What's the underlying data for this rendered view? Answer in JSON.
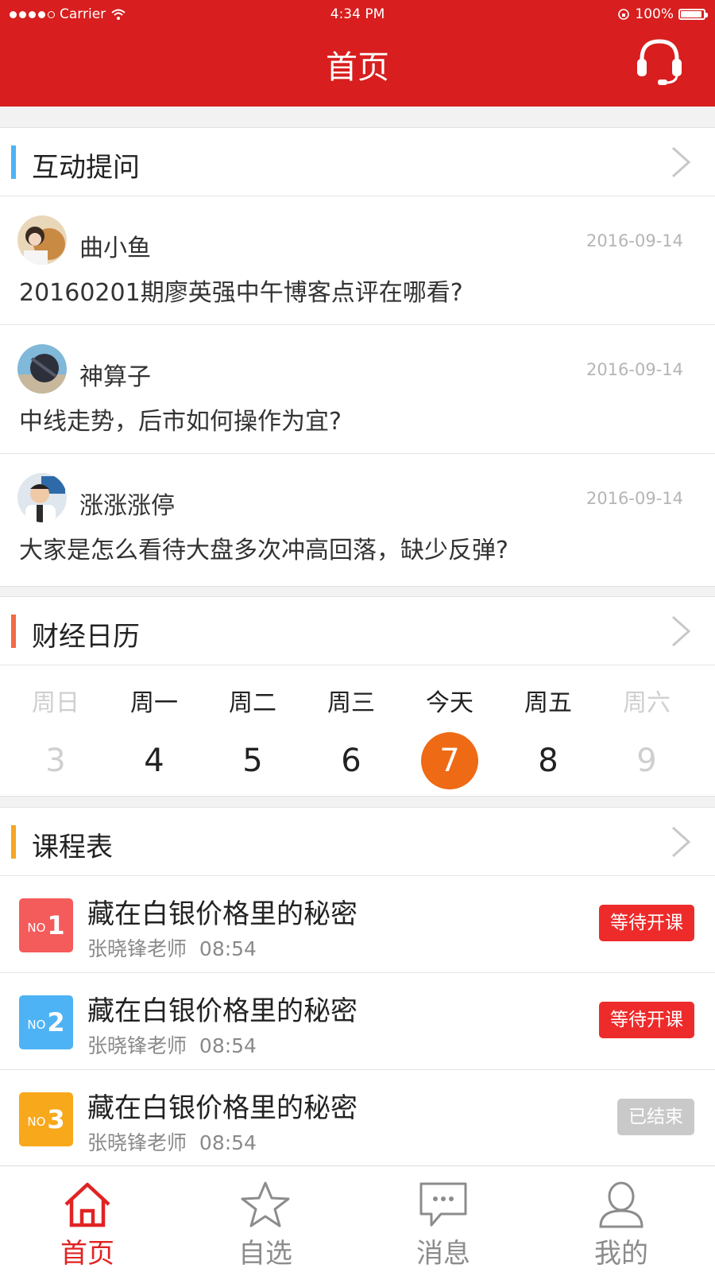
{
  "status_bar": {
    "carrier": "Carrier",
    "time": "4:34 PM",
    "battery": "100%"
  },
  "header": {
    "title": "首页",
    "support_icon": "headset-icon"
  },
  "qa": {
    "title": "互动提问",
    "accent": "#4db3f5",
    "items": [
      {
        "name": "曲小鱼",
        "date": "2016-09-14",
        "question": "20160201期廖英强中午博客点评在哪看?"
      },
      {
        "name": "神算子",
        "date": "2016-09-14",
        "question": "中线走势，后市如何操作为宜?"
      },
      {
        "name": "涨涨涨停",
        "date": "2016-09-14",
        "question": "大家是怎么看待大盘多次冲高回落，缺少反弹?"
      }
    ]
  },
  "calendar": {
    "title": "财经日历",
    "accent": "#f36a45",
    "today_color": "#ef6a14",
    "days": [
      {
        "name": "周日",
        "num": "3"
      },
      {
        "name": "周一",
        "num": "4"
      },
      {
        "name": "周二",
        "num": "5"
      },
      {
        "name": "周三",
        "num": "6"
      },
      {
        "name": "今天",
        "num": "7"
      },
      {
        "name": "周五",
        "num": "8"
      },
      {
        "name": "周六",
        "num": "9"
      }
    ]
  },
  "courses": {
    "title": "课程表",
    "accent": "#f6a623",
    "items": [
      {
        "no": "NO",
        "num": "1",
        "title": "藏在白银价格里的秘密",
        "teacher": "张晓锋老师",
        "time": "08:54",
        "status": "等待开课",
        "badge_color": "#f45b5b",
        "status_color": "#ee2b2b"
      },
      {
        "no": "NO",
        "num": "2",
        "title": "藏在白银价格里的秘密",
        "teacher": "张晓锋老师",
        "time": "08:54",
        "status": "等待开课",
        "badge_color": "#4db3f5",
        "status_color": "#ee2b2b"
      },
      {
        "no": "NO",
        "num": "3",
        "title": "藏在白银价格里的秘密",
        "teacher": "张晓锋老师",
        "time": "08:54",
        "status": "已结束",
        "badge_color": "#f8a81b",
        "status_color": "#c9c9c9"
      }
    ]
  },
  "tabbar": {
    "tabs": [
      {
        "label": "首页",
        "icon": "home-icon"
      },
      {
        "label": "自选",
        "icon": "star-icon"
      },
      {
        "label": "消息",
        "icon": "message-icon"
      },
      {
        "label": "我的",
        "icon": "user-icon"
      }
    ]
  },
  "colors": {
    "primary": "#d81e1e",
    "active_tab": "#e02424"
  }
}
